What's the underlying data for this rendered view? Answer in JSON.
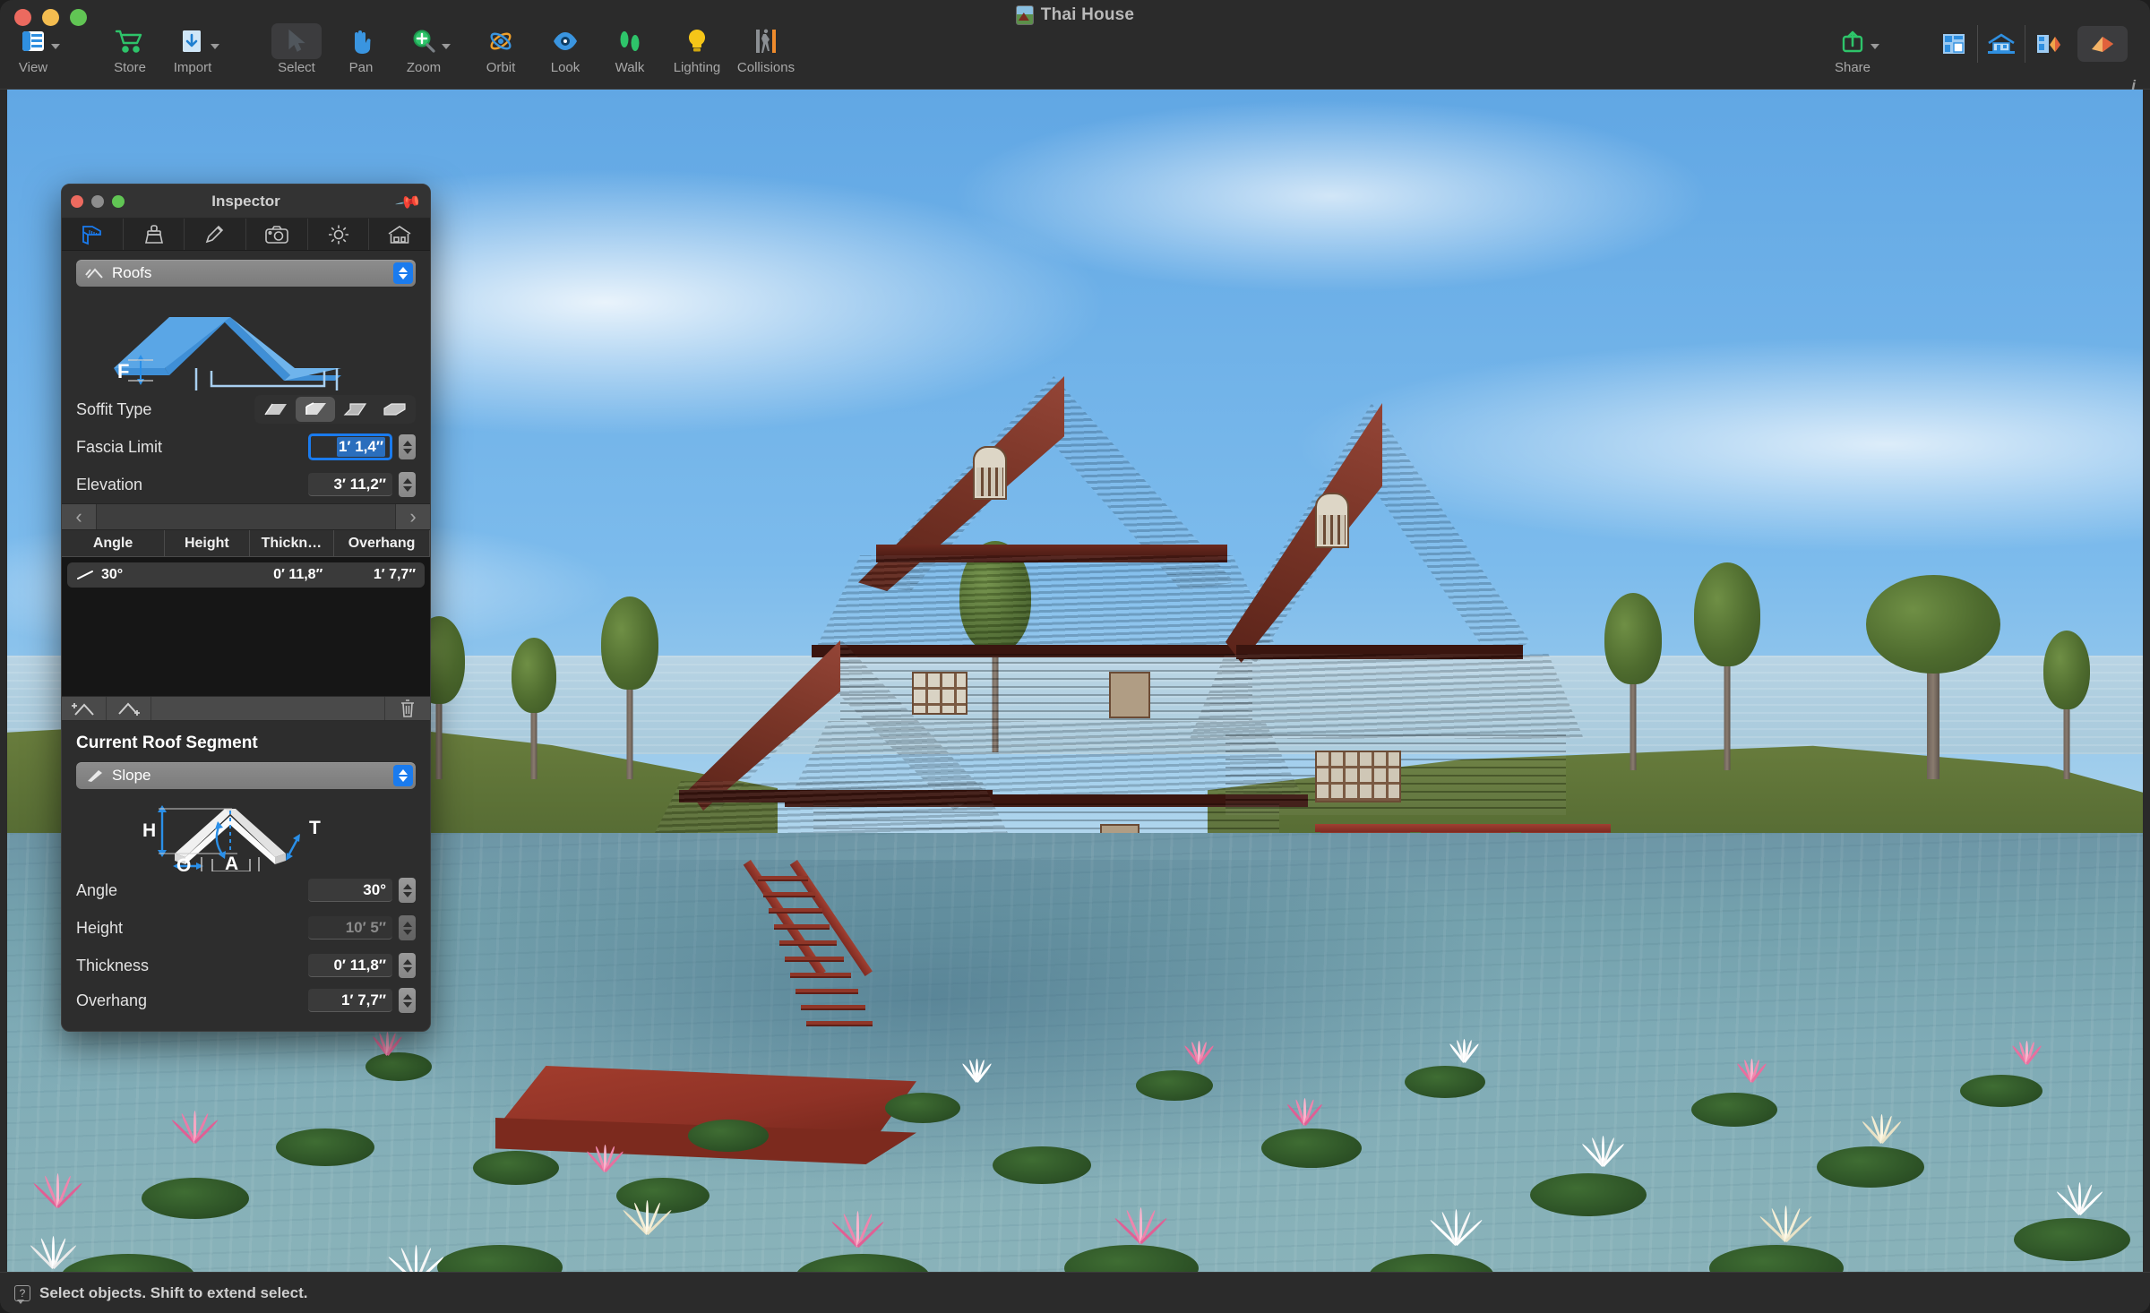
{
  "window": {
    "title": "Thai House",
    "doc_icon": "document-icon"
  },
  "toolbar": {
    "items": [
      {
        "label": "View",
        "icon": "view-panel-icon",
        "has_chevron": true,
        "active": false
      },
      {
        "label": "Store",
        "icon": "cart-icon",
        "has_chevron": false,
        "active": false
      },
      {
        "label": "Import",
        "icon": "import-icon",
        "has_chevron": true,
        "active": false
      },
      {
        "label": "Select",
        "icon": "cursor-arrow-icon",
        "has_chevron": false,
        "active": true
      },
      {
        "label": "Pan",
        "icon": "hand-icon",
        "has_chevron": false,
        "active": false
      },
      {
        "label": "Zoom",
        "icon": "magnifier-icon",
        "has_chevron": true,
        "active": false
      },
      {
        "label": "Orbit",
        "icon": "orbit-icon",
        "has_chevron": false,
        "active": false
      },
      {
        "label": "Look",
        "icon": "eye-icon",
        "has_chevron": false,
        "active": false
      },
      {
        "label": "Walk",
        "icon": "footsteps-icon",
        "has_chevron": false,
        "active": false
      },
      {
        "label": "Lighting",
        "icon": "lightbulb-icon",
        "has_chevron": false,
        "active": false
      },
      {
        "label": "Collisions",
        "icon": "collisions-icon",
        "has_chevron": false,
        "active": false
      }
    ],
    "share": {
      "label": "Share",
      "icon": "share-icon",
      "has_chevron": true
    },
    "view_mode": {
      "label": "View Mode",
      "options": [
        {
          "icon": "floorplan-icon",
          "active": false
        },
        {
          "icon": "elevation-icon",
          "active": false
        },
        {
          "icon": "plan-render-icon",
          "active": false
        },
        {
          "icon": "render-icon",
          "active": true
        }
      ]
    },
    "info_icon": "info-icon"
  },
  "inspector": {
    "title": "Inspector",
    "pin_icon": "pin-icon",
    "tabs": [
      {
        "icon": "caliper-icon",
        "selected": true
      },
      {
        "icon": "brush-icon",
        "selected": false
      },
      {
        "icon": "pencil-icon",
        "selected": false
      },
      {
        "icon": "camera-icon",
        "selected": false
      },
      {
        "icon": "sun-icon",
        "selected": false
      },
      {
        "icon": "house-icon",
        "selected": false
      }
    ],
    "category": {
      "label": "Roofs",
      "icon": "roof-icon"
    },
    "diagram_label": "F",
    "soffit": {
      "label": "Soffit Type",
      "options": [
        {
          "icon": "soffit-flat-icon",
          "selected": false
        },
        {
          "icon": "soffit-vertical-icon",
          "selected": true
        },
        {
          "icon": "soffit-angled-icon",
          "selected": false
        },
        {
          "icon": "soffit-stepped-icon",
          "selected": false
        }
      ]
    },
    "fields": [
      {
        "label": "Fascia Limit",
        "value": "1′ 1,4″",
        "focused": true,
        "disabled": false
      },
      {
        "label": "Elevation",
        "value": "3′ 11,2″",
        "focused": false,
        "disabled": false
      }
    ],
    "pager": {
      "prev_icon": "chevron-left-icon",
      "next_icon": "chevron-right-icon"
    },
    "table": {
      "columns": [
        "Angle",
        "Height",
        "Thickn…",
        "Overhang"
      ],
      "rows": [
        {
          "angle": "30°",
          "height": "",
          "thickness": "0′ 11,8″",
          "overhang": "1′ 7,7″",
          "icon": "slope-line-icon",
          "selected": true
        }
      ],
      "footer": {
        "add_icon": "add-roof-icon",
        "add_segment_icon": "add-roof-segment-icon",
        "delete_icon": "trash-icon"
      }
    },
    "segment": {
      "title": "Current Roof Segment",
      "type": {
        "label": "Slope",
        "icon": "slope-icon"
      },
      "diagram_labels": [
        "H",
        "T",
        "A",
        "O"
      ],
      "fields": [
        {
          "label": "Angle",
          "value": "30°",
          "disabled": false
        },
        {
          "label": "Height",
          "value": "10′ 5″",
          "disabled": true
        },
        {
          "label": "Thickness",
          "value": "0′ 11,8″",
          "disabled": false
        },
        {
          "label": "Overhang",
          "value": "1′ 7,7″",
          "disabled": false
        }
      ]
    }
  },
  "status": {
    "icon": "help-tooltip-icon",
    "text": "Select objects. Shift to extend select."
  },
  "colors": {
    "accent_blue": "#1a7bee",
    "panel_bg": "#2d2d2d",
    "chrome_bg": "#2b2b2b",
    "selection_blue": "#2a6ebd",
    "house_red": "#8f3226",
    "sky_blue": "#7cbbec"
  }
}
